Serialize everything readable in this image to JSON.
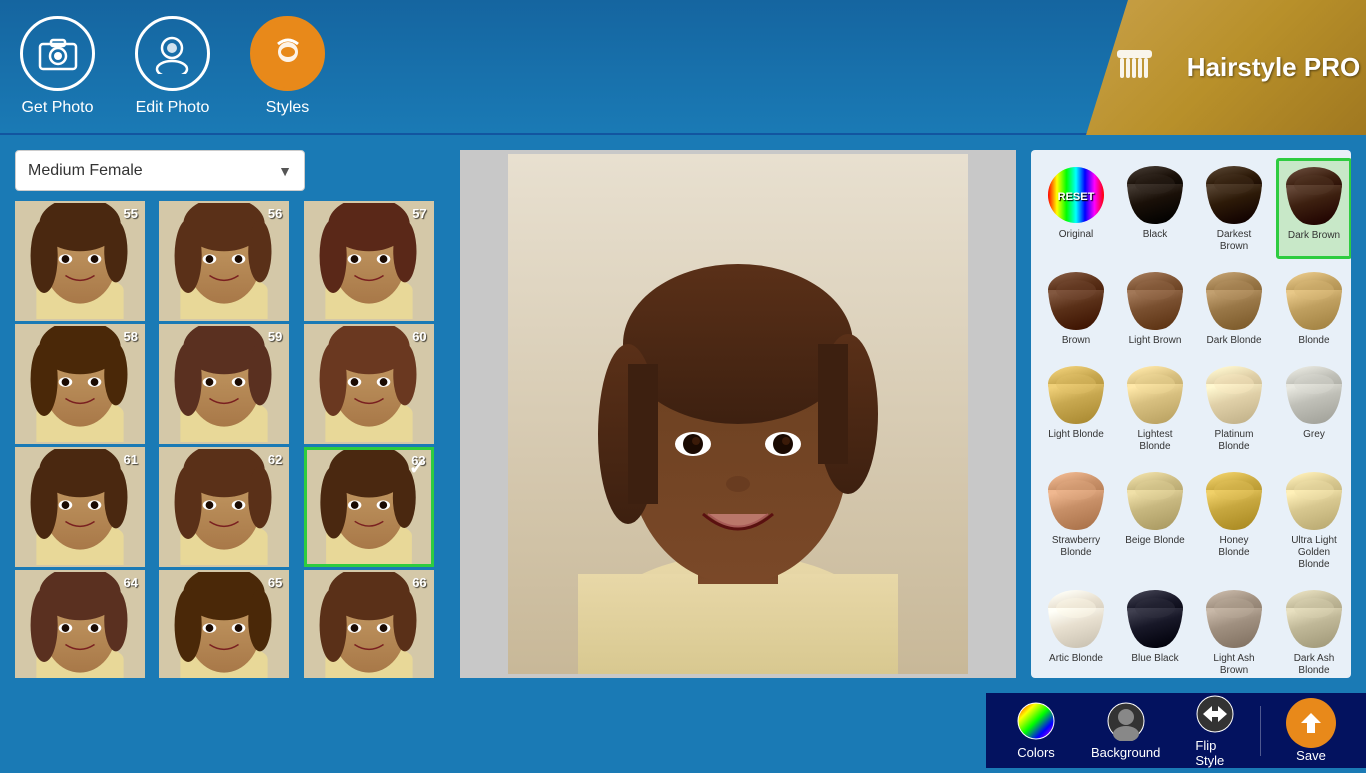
{
  "app": {
    "title": "Hairstyle PRO"
  },
  "header": {
    "nav": [
      {
        "id": "get-photo",
        "label": "Get Photo",
        "active": false
      },
      {
        "id": "edit-photo",
        "label": "Edit Photo",
        "active": false
      },
      {
        "id": "styles",
        "label": "Styles",
        "active": true
      }
    ]
  },
  "styles_panel": {
    "dropdown_label": "Medium Female",
    "dropdown_placeholder": "Medium Female",
    "styles": [
      {
        "number": "55",
        "selected": false
      },
      {
        "number": "56",
        "selected": false
      },
      {
        "number": "57",
        "selected": false
      },
      {
        "number": "58",
        "selected": false
      },
      {
        "number": "59",
        "selected": false
      },
      {
        "number": "60",
        "selected": false
      },
      {
        "number": "61",
        "selected": false
      },
      {
        "number": "62",
        "selected": false
      },
      {
        "number": "63",
        "selected": true
      },
      {
        "number": "64",
        "selected": false
      },
      {
        "number": "65",
        "selected": false
      },
      {
        "number": "66",
        "selected": false
      }
    ]
  },
  "colors_panel": {
    "swatches": [
      {
        "id": "original",
        "label": "Original",
        "type": "reset",
        "selected": false
      },
      {
        "id": "black",
        "label": "Black",
        "type": "hair",
        "color": "#1a1008",
        "selected": false
      },
      {
        "id": "darkest-brown",
        "label": "Darkest Brown",
        "type": "hair",
        "color": "#2d1a08",
        "selected": false
      },
      {
        "id": "dark-brown",
        "label": "Dark Brown",
        "type": "hair",
        "color": "#3d2010",
        "selected": true
      },
      {
        "id": "brown",
        "label": "Brown",
        "type": "hair",
        "color": "#5a3018",
        "selected": false
      },
      {
        "id": "light-brown",
        "label": "Light Brown",
        "type": "hair",
        "color": "#7a5030",
        "selected": false
      },
      {
        "id": "dark-blonde",
        "label": "Dark Blonde",
        "type": "hair",
        "color": "#9a7848",
        "selected": false
      },
      {
        "id": "blonde",
        "label": "Blonde",
        "type": "hair",
        "color": "#c0a060",
        "selected": false
      },
      {
        "id": "light-blonde",
        "label": "Light Blonde",
        "type": "hair",
        "color": "#c8a850",
        "selected": false
      },
      {
        "id": "lightest-blonde",
        "label": "Lightest Blonde",
        "type": "hair",
        "color": "#d8c080",
        "selected": false
      },
      {
        "id": "platinum-blonde",
        "label": "Platinum Blonde",
        "type": "hair",
        "color": "#e0d0a8",
        "selected": false
      },
      {
        "id": "grey",
        "label": "Grey",
        "type": "hair",
        "color": "#c0c0b8",
        "selected": false
      },
      {
        "id": "strawberry-blonde",
        "label": "Strawberry Blonde",
        "type": "hair",
        "color": "#c89068",
        "selected": false
      },
      {
        "id": "beige-blonde",
        "label": "Beige Blonde",
        "type": "hair",
        "color": "#c8b880",
        "selected": false
      },
      {
        "id": "honey-blonde",
        "label": "Honey Blonde",
        "type": "hair",
        "color": "#c8a840",
        "selected": false
      },
      {
        "id": "ultra-light-golden-blonde",
        "label": "Ultra Light Golden Blonde",
        "type": "hair",
        "color": "#d8c890",
        "selected": false
      },
      {
        "id": "artic-blonde",
        "label": "Artic Blonde",
        "type": "hair",
        "color": "#e8e0d0",
        "selected": false
      },
      {
        "id": "blue-black",
        "label": "Blue Black",
        "type": "hair",
        "color": "#181828",
        "selected": false
      },
      {
        "id": "light-ash-brown",
        "label": "Light Ash Brown",
        "type": "hair",
        "color": "#a09080",
        "selected": false
      },
      {
        "id": "dark-ash-blonde",
        "label": "Dark Ash Blonde",
        "type": "hair",
        "color": "#c0b898",
        "selected": false
      }
    ]
  },
  "toolbar": {
    "colors_label": "Colors",
    "background_label": "Background",
    "flip_style_label": "Flip Style",
    "save_label": "Save"
  }
}
